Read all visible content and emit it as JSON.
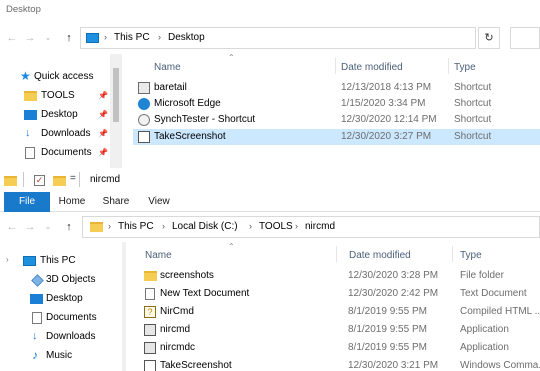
{
  "top_window": {
    "title": "Desktop",
    "nav": {
      "back": "←",
      "forward": "→",
      "dropdown": "⌄",
      "up": "↑",
      "refresh": "↻"
    },
    "breadcrumb": [
      "This PC",
      "Desktop"
    ],
    "breadcrumb_sep": "›",
    "quick_access": {
      "header": "Quick access",
      "items": [
        {
          "label": "TOOLS",
          "icon": "folder-icon",
          "pinned": true
        },
        {
          "label": "Desktop",
          "icon": "desktop-icon",
          "pinned": true
        },
        {
          "label": "Downloads",
          "icon": "download-icon",
          "pinned": true
        },
        {
          "label": "Documents",
          "icon": "documents-icon",
          "pinned": true
        }
      ]
    },
    "columns": {
      "name": "Name",
      "date": "Date modified",
      "type": "Type"
    },
    "files": [
      {
        "name": "baretail",
        "date": "12/13/2018 4:13 PM",
        "type": "Shortcut",
        "icon": "app-icon",
        "selected": false
      },
      {
        "name": "Microsoft Edge",
        "date": "1/15/2020 3:34 PM",
        "type": "Shortcut",
        "icon": "edge-icon",
        "selected": false
      },
      {
        "name": "SynchTester - Shortcut",
        "date": "12/30/2020 12:14 PM",
        "type": "Shortcut",
        "icon": "app-icon",
        "selected": false
      },
      {
        "name": "TakeScreenshot",
        "date": "12/30/2020 3:27 PM",
        "type": "Shortcut",
        "icon": "script-icon",
        "selected": true
      }
    ]
  },
  "bottom_window": {
    "title": "nircmd",
    "qat_sep": "=",
    "ribbon_tabs": [
      "File",
      "Home",
      "Share",
      "View"
    ],
    "breadcrumb": [
      "This PC",
      "Local Disk (C:)",
      "TOOLS",
      "nircmd"
    ],
    "breadcrumb_sep": "›",
    "nav_pane": [
      {
        "label": "This PC",
        "icon": "pc-icon"
      },
      {
        "label": "3D Objects",
        "icon": "3d-objects-icon"
      },
      {
        "label": "Desktop",
        "icon": "desktop-icon"
      },
      {
        "label": "Documents",
        "icon": "documents-icon"
      },
      {
        "label": "Downloads",
        "icon": "download-icon"
      },
      {
        "label": "Music",
        "icon": "music-icon"
      }
    ],
    "columns": {
      "name": "Name",
      "date": "Date modified",
      "type": "Type"
    },
    "files": [
      {
        "name": "screenshots",
        "date": "12/30/2020 3:28 PM",
        "type": "File folder",
        "icon": "folder-icon"
      },
      {
        "name": "New Text Document",
        "date": "12/30/2020 2:42 PM",
        "type": "Text Document",
        "icon": "text-file-icon"
      },
      {
        "name": "NirCmd",
        "date": "8/1/2019 9:55 PM",
        "type": "Compiled HTML ...",
        "icon": "help-file-icon"
      },
      {
        "name": "nircmd",
        "date": "8/1/2019 9:55 PM",
        "type": "Application",
        "icon": "exe-icon"
      },
      {
        "name": "nircmdc",
        "date": "8/1/2019 9:55 PM",
        "type": "Application",
        "icon": "exe-icon"
      },
      {
        "name": "TakeScreenshot",
        "date": "12/30/2020 3:21 PM",
        "type": "Windows Comma...",
        "icon": "script-icon"
      }
    ]
  },
  "colors": {
    "selection": "#cce8ff",
    "file_tab": "#1979ca",
    "header_text": "#4c607a",
    "accent_blue": "#1e90e0",
    "folder_yellow": "#f5cd52"
  }
}
